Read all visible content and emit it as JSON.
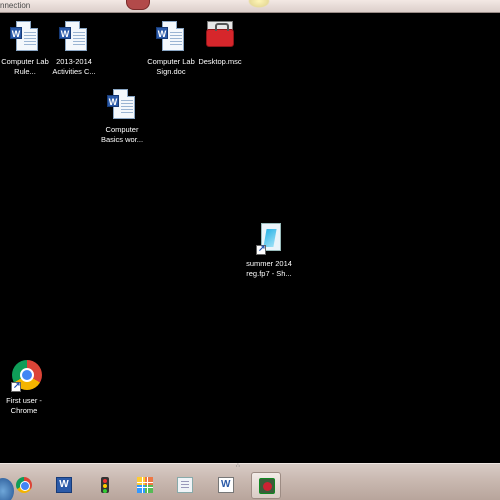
{
  "window": {
    "title": "nnection"
  },
  "desktop": {
    "icons": [
      {
        "label": "Computer Lab Rule...",
        "icon": "word-document-icon"
      },
      {
        "label": "2013-2014 Activities C...",
        "icon": "word-document-icon"
      },
      {
        "label": "Computer Lab Sign.doc",
        "icon": "word-document-icon"
      },
      {
        "label": "Desktop.msc",
        "icon": "toolbox-icon"
      },
      {
        "label": "Computer Basics wor...",
        "icon": "word-document-icon"
      },
      {
        "label": "summer 2014 reg.fp7 - Sh...",
        "icon": "filemaker-shortcut-icon"
      },
      {
        "label": "First user - Chrome",
        "icon": "chrome-shortcut-icon"
      }
    ]
  },
  "taskbar": {
    "items": [
      {
        "name": "start-button",
        "icon": "windows-start-icon"
      },
      {
        "name": "chrome",
        "icon": "chrome-icon"
      },
      {
        "name": "word",
        "icon": "word-icon"
      },
      {
        "name": "traffic-light",
        "icon": "traffic-light-icon"
      },
      {
        "name": "app-grid",
        "icon": "app-grid-icon"
      },
      {
        "name": "document",
        "icon": "document-icon"
      },
      {
        "name": "word-files",
        "icon": "word-files-icon"
      },
      {
        "name": "remote-desktop",
        "icon": "remote-desktop-icon",
        "active": true
      }
    ]
  }
}
